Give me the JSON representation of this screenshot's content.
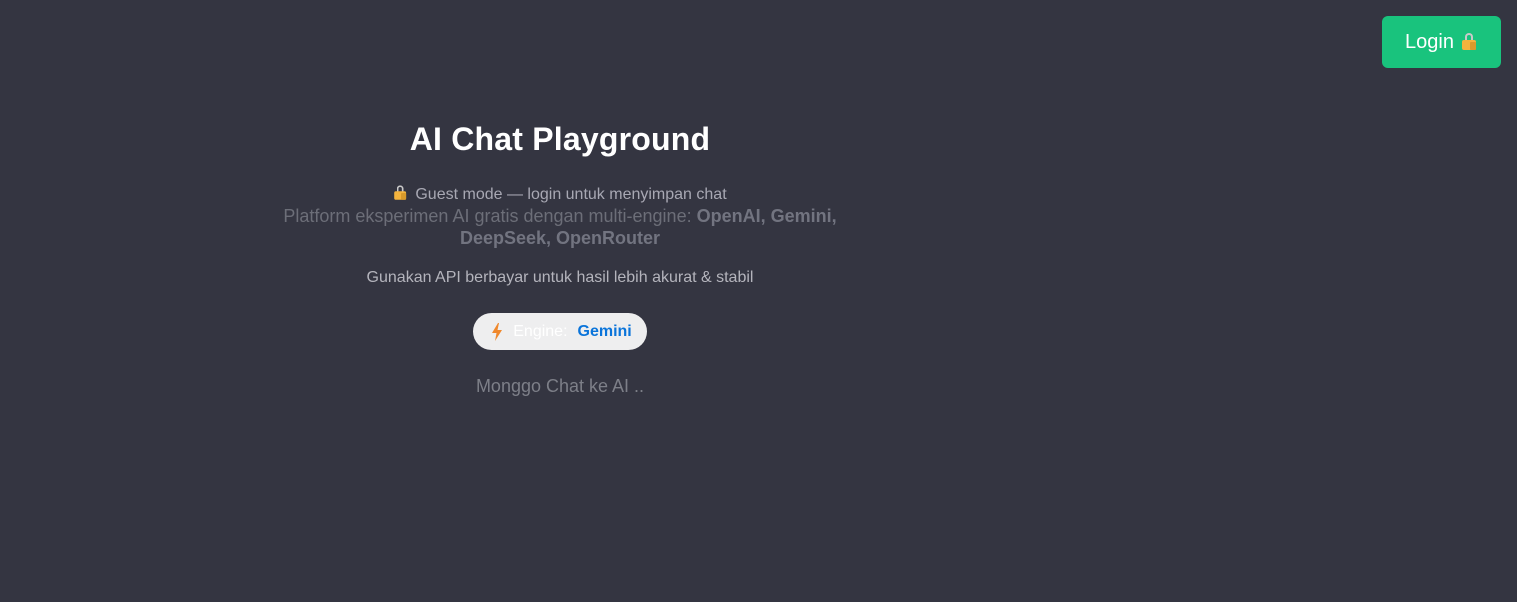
{
  "header": {
    "login_label": "Login",
    "login_icon": "lock-icon"
  },
  "hero": {
    "title": "AI Chat Playground",
    "guest_icon": "lock-icon",
    "guest_text": "Guest mode — login untuk menyimpan chat",
    "platform_text": "Platform eksperimen AI gratis dengan multi-engine: ",
    "platform_engines": "OpenAI, Gemini, DeepSeek, OpenRouter",
    "api_note": "Gunakan API berbayar untuk hasil lebih akurat & stabil",
    "engine": {
      "icon": "lightning-bolt-icon",
      "label": "Engine:",
      "value": "Gemini"
    },
    "chat_prompt": "Monggo Chat ke AI .."
  },
  "colors": {
    "background": "#343541",
    "login_button": "#19c37d",
    "engine_value": "#0a74da"
  }
}
